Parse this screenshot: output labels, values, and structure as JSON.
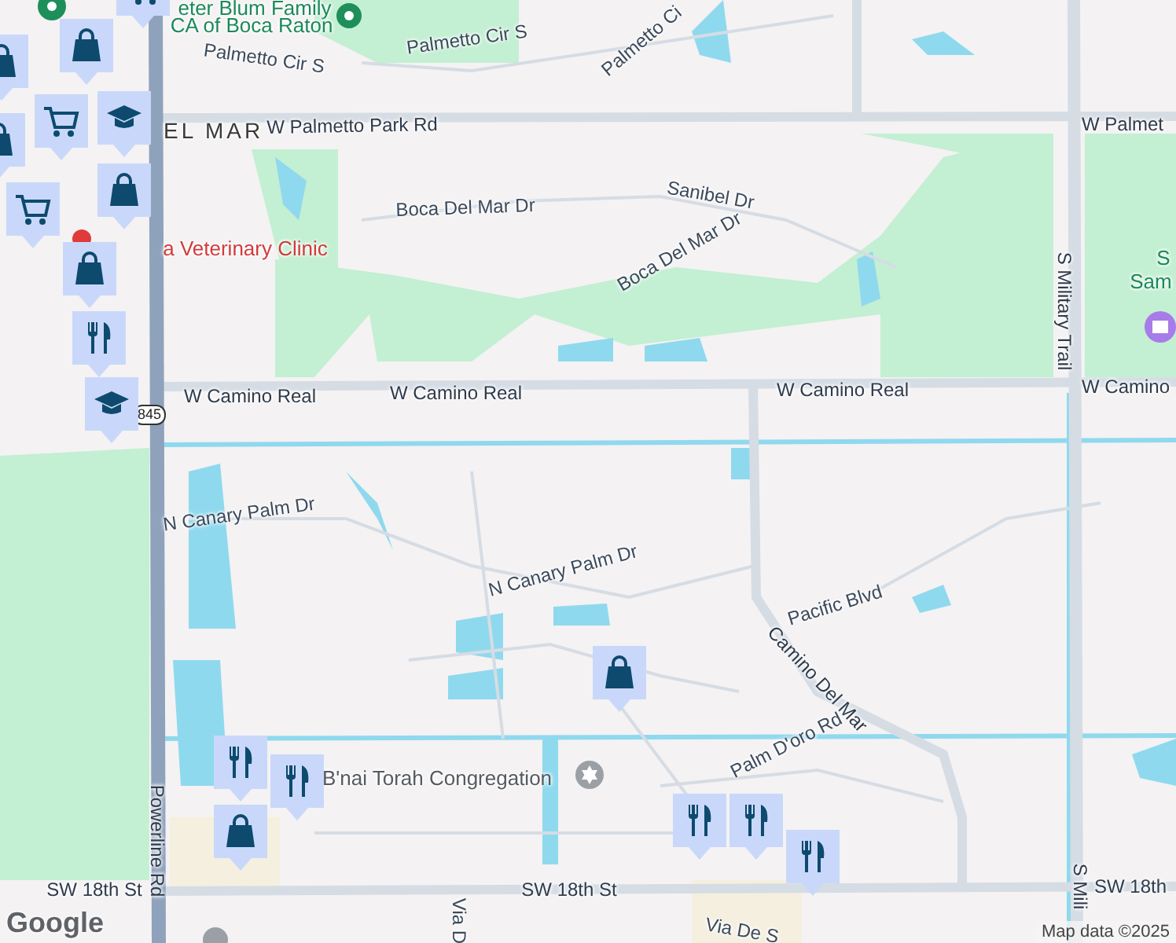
{
  "map": {
    "labels": [
      {
        "text": "eter Blum Family",
        "kind": "poi-green"
      },
      {
        "text": "CA of Boca Raton",
        "kind": "poi-green"
      },
      {
        "text": "Palmetto Cir S",
        "kind": "street"
      },
      {
        "text": "Palmetto Cir S",
        "kind": "street"
      },
      {
        "text": "Palmetto Ci",
        "kind": "street"
      },
      {
        "text": "EL MAR",
        "kind": "area"
      },
      {
        "text": "W Palmetto Park Rd",
        "kind": "road"
      },
      {
        "text": "W Palmet",
        "kind": "road"
      },
      {
        "text": "Boca Del Mar Dr",
        "kind": "street"
      },
      {
        "text": "Sanibel Dr",
        "kind": "street"
      },
      {
        "text": "Boca Del Mar Dr",
        "kind": "street"
      },
      {
        "text": "a Veterinary Clinic",
        "kind": "poi-red"
      },
      {
        "text": "S Military Trail",
        "kind": "road"
      },
      {
        "text": "S",
        "kind": "poi-green"
      },
      {
        "text": "Sam",
        "kind": "poi-green"
      },
      {
        "text": "W Camino Real",
        "kind": "road"
      },
      {
        "text": "W Camino Real",
        "kind": "road"
      },
      {
        "text": "W Camino Real",
        "kind": "road"
      },
      {
        "text": "W Camino",
        "kind": "road"
      },
      {
        "text": "845",
        "kind": "shield"
      },
      {
        "text": "N Canary Palm Dr",
        "kind": "street"
      },
      {
        "text": "N Canary Palm Dr",
        "kind": "street"
      },
      {
        "text": "Pacific Blvd",
        "kind": "street"
      },
      {
        "text": "Camino Del Mar",
        "kind": "road"
      },
      {
        "text": "Palm D'oro Rd",
        "kind": "street"
      },
      {
        "text": "B'nai Torah Congregation",
        "kind": "poi-grey"
      },
      {
        "text": "Powerline Rd",
        "kind": "road"
      },
      {
        "text": "SW 18th St",
        "kind": "road"
      },
      {
        "text": "SW 18th St",
        "kind": "road"
      },
      {
        "text": "SW 18th",
        "kind": "road"
      },
      {
        "text": "Via D",
        "kind": "street"
      },
      {
        "text": "Via De S",
        "kind": "street"
      },
      {
        "text": "S Mili",
        "kind": "road"
      }
    ],
    "markers": [
      {
        "kind": "cart"
      },
      {
        "kind": "shopping"
      },
      {
        "kind": "shopping"
      },
      {
        "kind": "school"
      },
      {
        "kind": "cart"
      },
      {
        "kind": "shopping"
      },
      {
        "kind": "cart"
      },
      {
        "kind": "shopping"
      },
      {
        "kind": "shopping"
      },
      {
        "kind": "restaurant"
      },
      {
        "kind": "school"
      },
      {
        "kind": "restaurant"
      },
      {
        "kind": "restaurant"
      },
      {
        "kind": "shopping"
      },
      {
        "kind": "shopping"
      },
      {
        "kind": "restaurant"
      },
      {
        "kind": "restaurant"
      },
      {
        "kind": "restaurant"
      }
    ],
    "logo": "Google",
    "attribution": "Map data ©2025"
  }
}
